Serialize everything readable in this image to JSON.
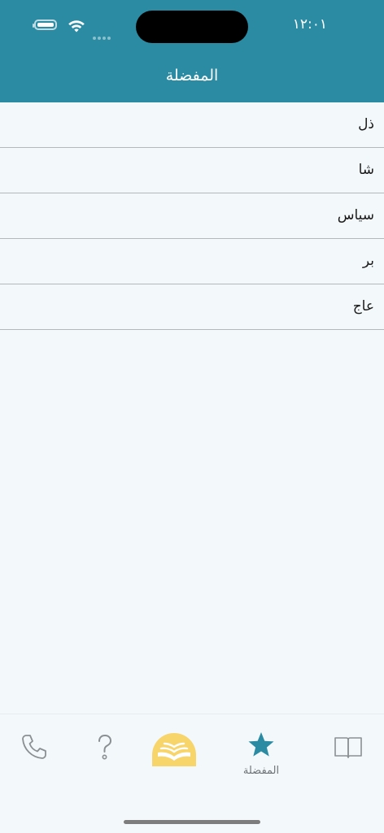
{
  "status_bar": {
    "time": "١٢:٠١"
  },
  "header": {
    "title": "المفضلة"
  },
  "favorites": [
    {
      "label": "ذل"
    },
    {
      "label": "شا"
    },
    {
      "label": "سياس"
    },
    {
      "label": "بر"
    },
    {
      "label": "عاج"
    }
  ],
  "tabbar": {
    "active_tab": "favorites",
    "favorites_label": "المفضلة",
    "tabs": [
      {
        "id": "phone",
        "icon": "phone-icon"
      },
      {
        "id": "help",
        "icon": "question-icon"
      },
      {
        "id": "home",
        "icon": "book-logo-icon"
      },
      {
        "id": "favorites",
        "icon": "star-icon"
      },
      {
        "id": "dictionary",
        "icon": "open-book-icon"
      }
    ]
  },
  "colors": {
    "header_bg": "#2a8ba3",
    "accent": "#2a8ba3",
    "logo_yellow": "#f7d56a",
    "background": "#f3f8fa",
    "divider": "#b3b8bb"
  }
}
